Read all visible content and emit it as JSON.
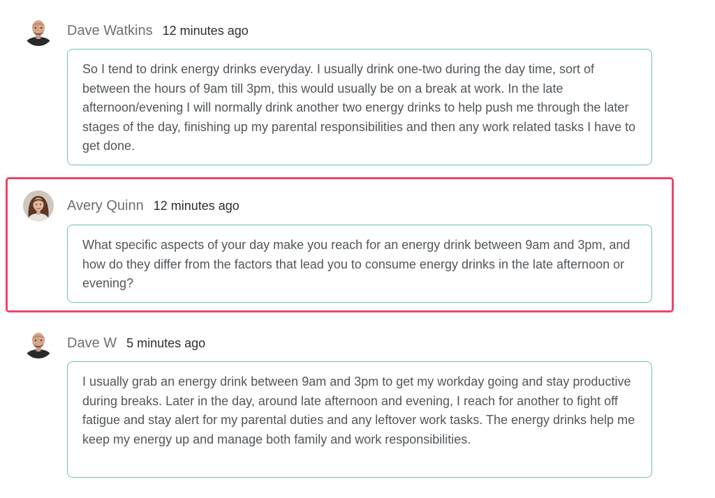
{
  "comments": [
    {
      "author": "Dave Watkins",
      "time": "12 minutes ago",
      "avatar_icon": "man-avatar",
      "text": "So I tend to drink energy drinks everyday. I usually drink one-two during the day time, sort of between the hours of 9am till 3pm, this would usually be on a break at work. In the late afternoon/evening I will normally drink another two energy drinks to help push me through the later stages of the day, finishing up my parental responsibilities and then any work related tasks I have to get done."
    },
    {
      "author": "Avery Quinn",
      "time": "12 minutes ago",
      "avatar_icon": "woman-avatar",
      "highlighted": true,
      "text": "What specific aspects of your day make you reach for an energy drink between 9am and 3pm, and how do they differ from the factors that lead you to consume energy drinks in the late afternoon or evening?"
    },
    {
      "author": "Dave W",
      "time": "5 minutes ago",
      "avatar_icon": "man-avatar",
      "text": "I usually grab an energy drink between 9am and 3pm to get my workday going and stay productive during breaks. Later in the day, around late afternoon and evening, I reach for another to fight off fatigue and stay alert for my parental duties and any leftover work tasks. The energy drinks help me keep my energy up and manage both family and work responsibilities."
    }
  ],
  "colors": {
    "bubble_border": "#6cc4a4",
    "highlight_border": "#ee4466",
    "author_text": "#6b6f73",
    "body_text": "#50565b"
  }
}
